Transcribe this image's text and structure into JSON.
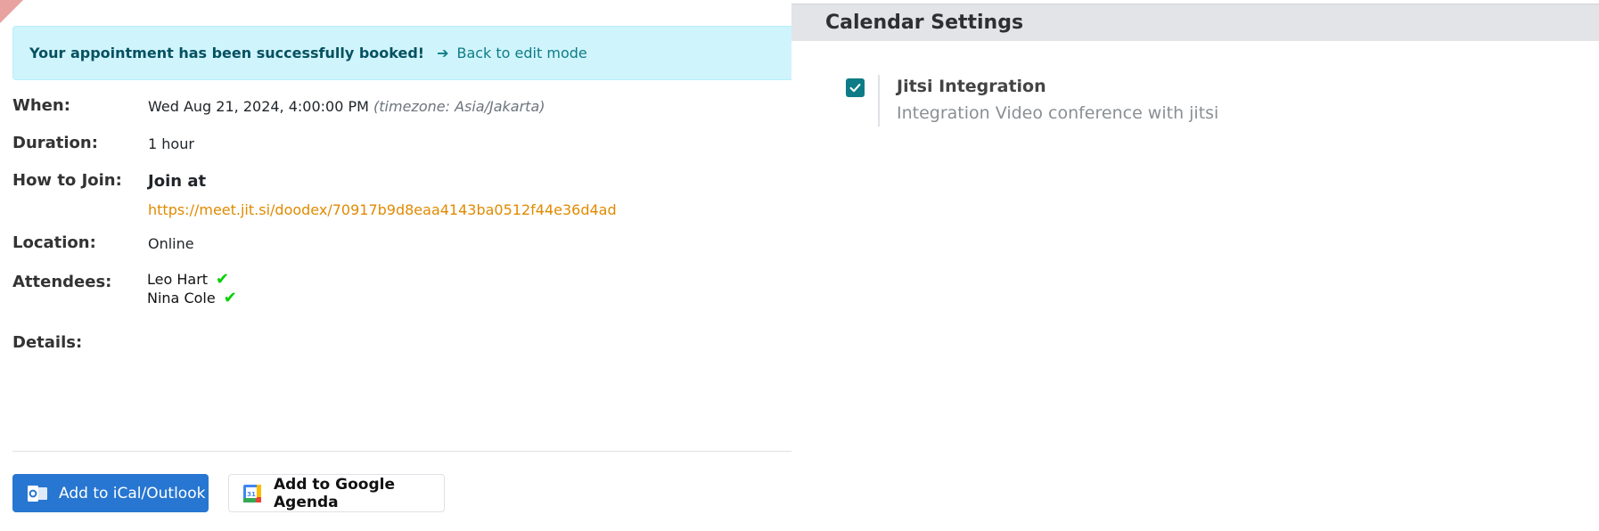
{
  "alert": {
    "message": "Your appointment has been successfully booked!",
    "back_link": "Back to edit mode"
  },
  "details": {
    "when_label": "When:",
    "when_value": "Wed Aug 21, 2024, 4:00:00 PM",
    "timezone": "(timezone: Asia/Jakarta)",
    "duration_label": "Duration:",
    "duration_value": "1 hour",
    "join_label": "How to Join:",
    "join_title": "Join at",
    "join_url": "https://meet.jit.si/doodex/70917b9d8eaa4143ba0512f44e36d4ad",
    "location_label": "Location:",
    "location_value": "Online",
    "attendees_label": "Attendees:",
    "attendees": [
      "Leo Hart",
      "Nina Cole"
    ],
    "details_label": "Details:"
  },
  "buttons": {
    "ical": "Add to iCal/Outlook",
    "google": "Add to Google Agenda"
  },
  "settings": {
    "title": "Calendar Settings",
    "item_name": "Jitsi Integration",
    "item_desc": "Integration Video conference with jitsi",
    "checked": true
  },
  "colors": {
    "accent": "#0e7c86",
    "primary_button": "#2776d1",
    "link_orange": "#e08a00",
    "alert_bg": "#cff4fc"
  },
  "icons": [
    "arrow-right-icon",
    "check-icon",
    "outlook-icon",
    "google-calendar-icon"
  ]
}
